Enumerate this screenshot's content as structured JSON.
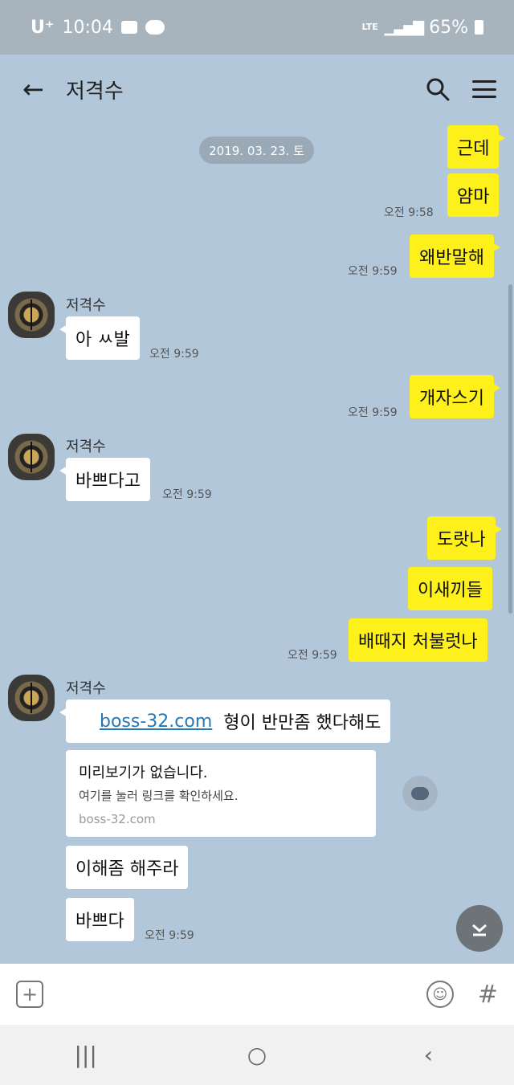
{
  "status_bar": {
    "carrier": "U⁺",
    "time": "10:04",
    "network": "LTE",
    "battery": "65%"
  },
  "header": {
    "back_icon": "back-arrow-icon",
    "title": "저격수",
    "search_icon": "search-icon",
    "menu_icon": "menu-icon"
  },
  "chat": {
    "date_divider": "2019. 03. 23. 토",
    "messages": [
      {
        "from": "me",
        "text": "근데"
      },
      {
        "from": "me",
        "text": "얌마",
        "time": "오전 9:58"
      },
      {
        "from": "me",
        "text": "왜반말해",
        "time": "오전 9:59"
      },
      {
        "from": "them",
        "sender": "저격수",
        "text": "아 ㅆ발",
        "time": "오전 9:59"
      },
      {
        "from": "me",
        "text": "개자스기",
        "time": "오전 9:59"
      },
      {
        "from": "them",
        "sender": "저격수",
        "text": "바쁘다고",
        "time": "오전 9:59"
      },
      {
        "from": "me",
        "text": "도랏나"
      },
      {
        "from": "me",
        "text": "이새끼들"
      },
      {
        "from": "me",
        "text": "배때지 처불럿나",
        "time": "오전 9:59"
      },
      {
        "from": "them",
        "sender": "저격수",
        "link": "boss-32.com",
        "text": "형이 반만좀 했다해도"
      },
      {
        "from": "them",
        "text": "이해좀 해주라"
      },
      {
        "from": "them",
        "text": "바쁘다",
        "time": "오전 9:59"
      }
    ],
    "link_preview": {
      "title": "미리보기가 없습니다.",
      "subtitle": "여기를 눌러 링크를 확인하세요.",
      "domain": "boss-32.com"
    },
    "partial_sender": "저격수"
  },
  "input_bar": {
    "attach_icon": "plus-icon",
    "emoji_icon": "emoji-icon",
    "hash_label": "#"
  },
  "nav_bar": {
    "recents_icon": "recents-icon",
    "home_icon": "home-icon",
    "back_icon": "back-icon"
  }
}
